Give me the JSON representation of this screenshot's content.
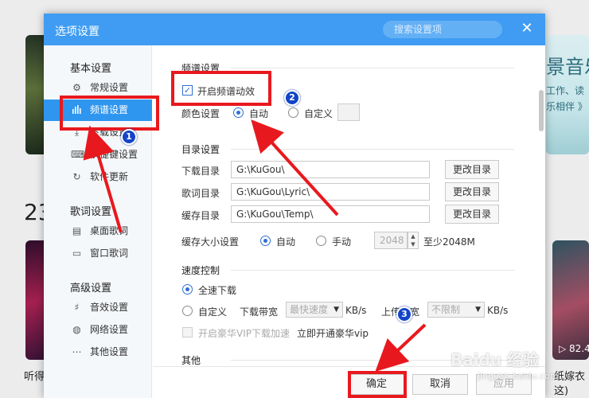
{
  "background": {
    "number": "23",
    "bottom_left_text": "听得",
    "right_heading": "景音乐",
    "right_line1": "工作、读",
    "right_line2": "乐相伴 》",
    "right_play_count": "▷ 82.4",
    "right_bottom_line1": "纸嫁衣",
    "right_bottom_line2": "这)"
  },
  "dialog": {
    "title": "选项设置",
    "search_placeholder": "搜索设置项",
    "close_icon": "close-icon"
  },
  "sidebar": {
    "groups": [
      {
        "title": "基本设置",
        "items": [
          {
            "label": "常规设置",
            "icon": "gear-icon"
          },
          {
            "label": "频谱设置",
            "icon": "spectrum-icon",
            "active": true
          },
          {
            "label": "下载设置",
            "icon": "download-icon"
          },
          {
            "label": "快捷键设置",
            "icon": "keyboard-icon"
          },
          {
            "label": "软件更新",
            "icon": "update-icon"
          }
        ]
      },
      {
        "title": "歌词设置",
        "items": [
          {
            "label": "桌面歌词",
            "icon": "desktop-lyric-icon"
          },
          {
            "label": "窗口歌词",
            "icon": "window-lyric-icon"
          }
        ]
      },
      {
        "title": "高级设置",
        "items": [
          {
            "label": "音效设置",
            "icon": "equalizer-icon"
          },
          {
            "label": "网络设置",
            "icon": "network-icon"
          },
          {
            "label": "其他设置",
            "icon": "more-icon"
          }
        ]
      }
    ]
  },
  "spectrum": {
    "section_title": "频谱设置",
    "enable_label": "开启频谱动效",
    "enable_checked": true,
    "color_label": "颜色设置",
    "color_auto": "自动",
    "color_custom": "自定义"
  },
  "directory": {
    "section_title": "目录设置",
    "rows": [
      {
        "label": "下载目录",
        "value": "G:\\KuGou\\",
        "button": "更改目录"
      },
      {
        "label": "歌词目录",
        "value": "G:\\KuGou\\Lyric\\",
        "button": "更改目录"
      },
      {
        "label": "缓存目录",
        "value": "G:\\KuGou\\Temp\\",
        "button": "更改目录"
      }
    ],
    "cache_size_label": "缓存大小设置",
    "cache_auto": "自动",
    "cache_manual": "手动",
    "cache_value": "2048",
    "cache_hint": "至少2048M"
  },
  "speed": {
    "section_title": "速度控制",
    "full_speed": "全速下载",
    "custom": "自定义",
    "download_bandwidth": "下载带宽",
    "download_select": "最快速度",
    "unit": "KB/s",
    "upload_bandwidth": "上传带宽",
    "upload_select": "不限制",
    "vip_accel": "开启豪华VIP下载加速",
    "vip_link": "立即开通豪华vip"
  },
  "other": {
    "section_title": "其他"
  },
  "footer": {
    "ok": "确定",
    "cancel": "取消",
    "apply": "应用"
  },
  "annotations": {
    "badge1": "1",
    "badge2": "2",
    "badge3": "3",
    "color": "#e8191e",
    "badge_color": "#1344c8"
  },
  "watermark": {
    "text": "Baidu 经验",
    "sub": "jingyan.baidu.com"
  },
  "colors": {
    "titlebar": "#3f9cf2",
    "active_item": "#2f96f0",
    "accent": "#2f6fd1"
  }
}
